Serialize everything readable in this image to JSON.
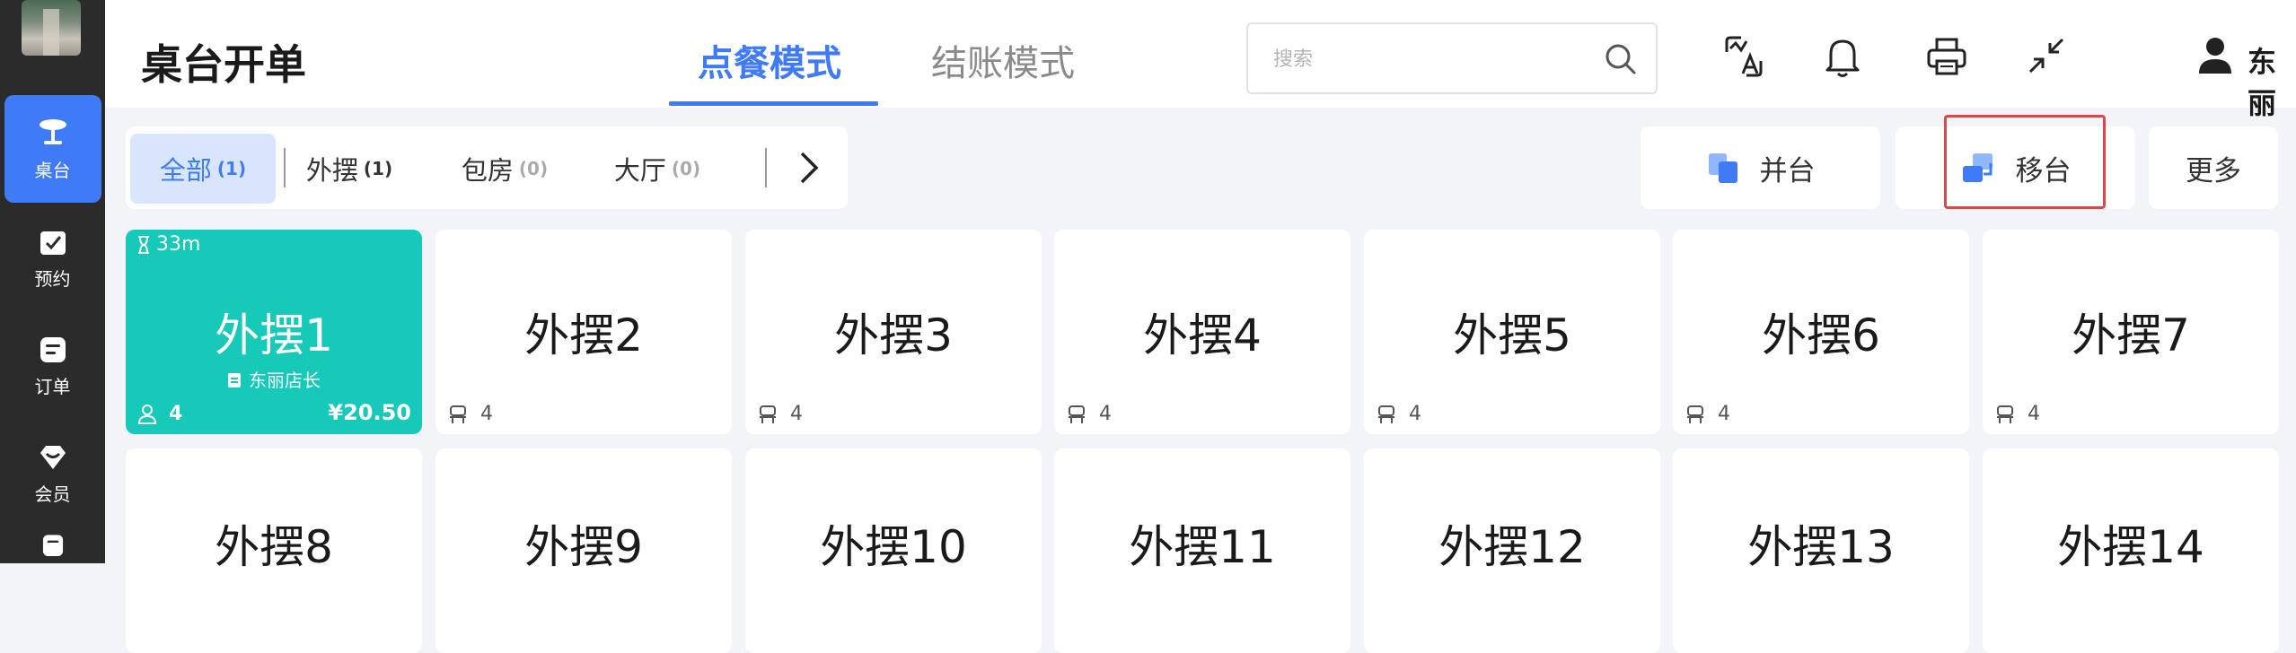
{
  "sidebar": {
    "items": [
      {
        "label": "桌台",
        "icon": "table-icon"
      },
      {
        "label": "预约",
        "icon": "reservation-icon"
      },
      {
        "label": "订单",
        "icon": "order-icon"
      },
      {
        "label": "会员",
        "icon": "member-icon"
      }
    ]
  },
  "header": {
    "title": "桌台开单",
    "modes": [
      "点餐模式",
      "结账模式"
    ],
    "search_placeholder": "搜索",
    "user_name": "东丽店长"
  },
  "filters": [
    {
      "label": "全部",
      "count": "(1)"
    },
    {
      "label": "外摆",
      "count": "(1)"
    },
    {
      "label": "包房",
      "count": "(0)"
    },
    {
      "label": "大厅",
      "count": "(0)"
    }
  ],
  "actions": {
    "merge": "并台",
    "move": "移台",
    "more": "更多"
  },
  "tables": [
    {
      "name": "外摆1",
      "seats": "4",
      "status": "occupied",
      "time": "33m",
      "waiter": "东丽店长",
      "amount": "¥20.50"
    },
    {
      "name": "外摆2",
      "seats": "4"
    },
    {
      "name": "外摆3",
      "seats": "4"
    },
    {
      "name": "外摆4",
      "seats": "4"
    },
    {
      "name": "外摆5",
      "seats": "4"
    },
    {
      "name": "外摆6",
      "seats": "4"
    },
    {
      "name": "外摆7",
      "seats": "4"
    },
    {
      "name": "外摆8"
    },
    {
      "name": "外摆9"
    },
    {
      "name": "外摆10"
    },
    {
      "name": "外摆11"
    },
    {
      "name": "外摆12"
    },
    {
      "name": "外摆13"
    },
    {
      "name": "外摆14"
    }
  ],
  "colors": {
    "accent": "#3f7bf6",
    "occupied": "#17c9b8",
    "sidebar": "#2b2b2b",
    "highlight": "#e04646"
  }
}
